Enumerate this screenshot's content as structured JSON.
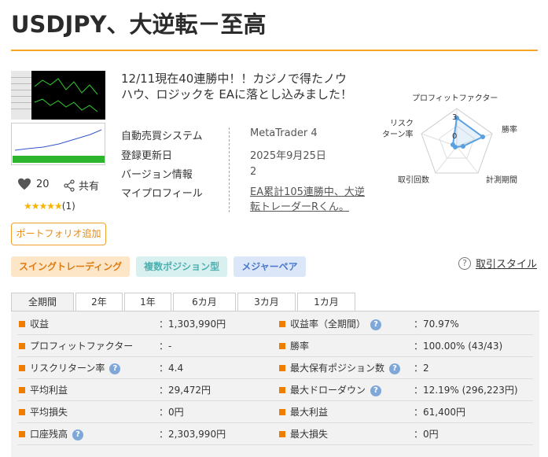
{
  "title": "USDJPY、大逆転－至高",
  "description": "12/11現在40連勝中！！カジノで得たノウハウ、ロジックを EAに落とし込みました！",
  "likes": "20",
  "share_label": "共有",
  "stars_count": "(1)",
  "portfolio_button": "ポートフォリオ追加",
  "info": {
    "system_label": "自動売買システム",
    "system_value": "MetaTrader 4",
    "updated_label": "登録更新日",
    "updated_value": "2025年9月25日",
    "version_label": "バージョン情報",
    "version_value": "2",
    "profile_label": "マイプロフィール",
    "profile_value_1": "EA累計105連勝中、大逆",
    "profile_value_2": "転トレーダーRくん。"
  },
  "radar": {
    "labels": {
      "pf": "プロフィットファクター",
      "win": "勝率",
      "risk_1": "リスク",
      "risk_2": "ターン率",
      "trades": "取引回数",
      "period": "計測期間"
    },
    "tick_outer": "3",
    "tick_inner": "0"
  },
  "tags": [
    "スイングトレーディング",
    "複数ポジション型",
    "メジャーペア"
  ],
  "style_link": "取引スタイル",
  "tabs": [
    "全期間",
    "2年",
    "1年",
    "6カ月",
    "3カ月",
    "1カ月"
  ],
  "stats_left": [
    {
      "label": "収益",
      "value": "：1,303,990円",
      "hint": false
    },
    {
      "label": "プロフィットファクター",
      "value": "：-",
      "hint": false
    },
    {
      "label": "リスクリターン率",
      "value": "：4.4",
      "hint": true
    },
    {
      "label": "平均利益",
      "value": "：29,472円",
      "hint": false
    },
    {
      "label": "平均損失",
      "value": "：0円",
      "hint": false
    },
    {
      "label": "口座残高",
      "value": "：2,303,990円",
      "hint": true
    }
  ],
  "stats_right": [
    {
      "label": "収益率（全期間）",
      "value": "：70.97%",
      "hint": true
    },
    {
      "label": "勝率",
      "value": "：100.00% (43/43)",
      "hint": false
    },
    {
      "label": "最大保有ポジション数",
      "value": "：2",
      "hint": true
    },
    {
      "label": "最大ドローダウン",
      "value": "：12.19% (296,223円)",
      "hint": true
    },
    {
      "label": "最大利益",
      "value": "：61,400円",
      "hint": false
    },
    {
      "label": "最大損失",
      "value": "：0円",
      "hint": false
    }
  ],
  "colors": {
    "accent": "#f5a623",
    "orange": "#f07c00",
    "radar": "#5aa0e0"
  }
}
